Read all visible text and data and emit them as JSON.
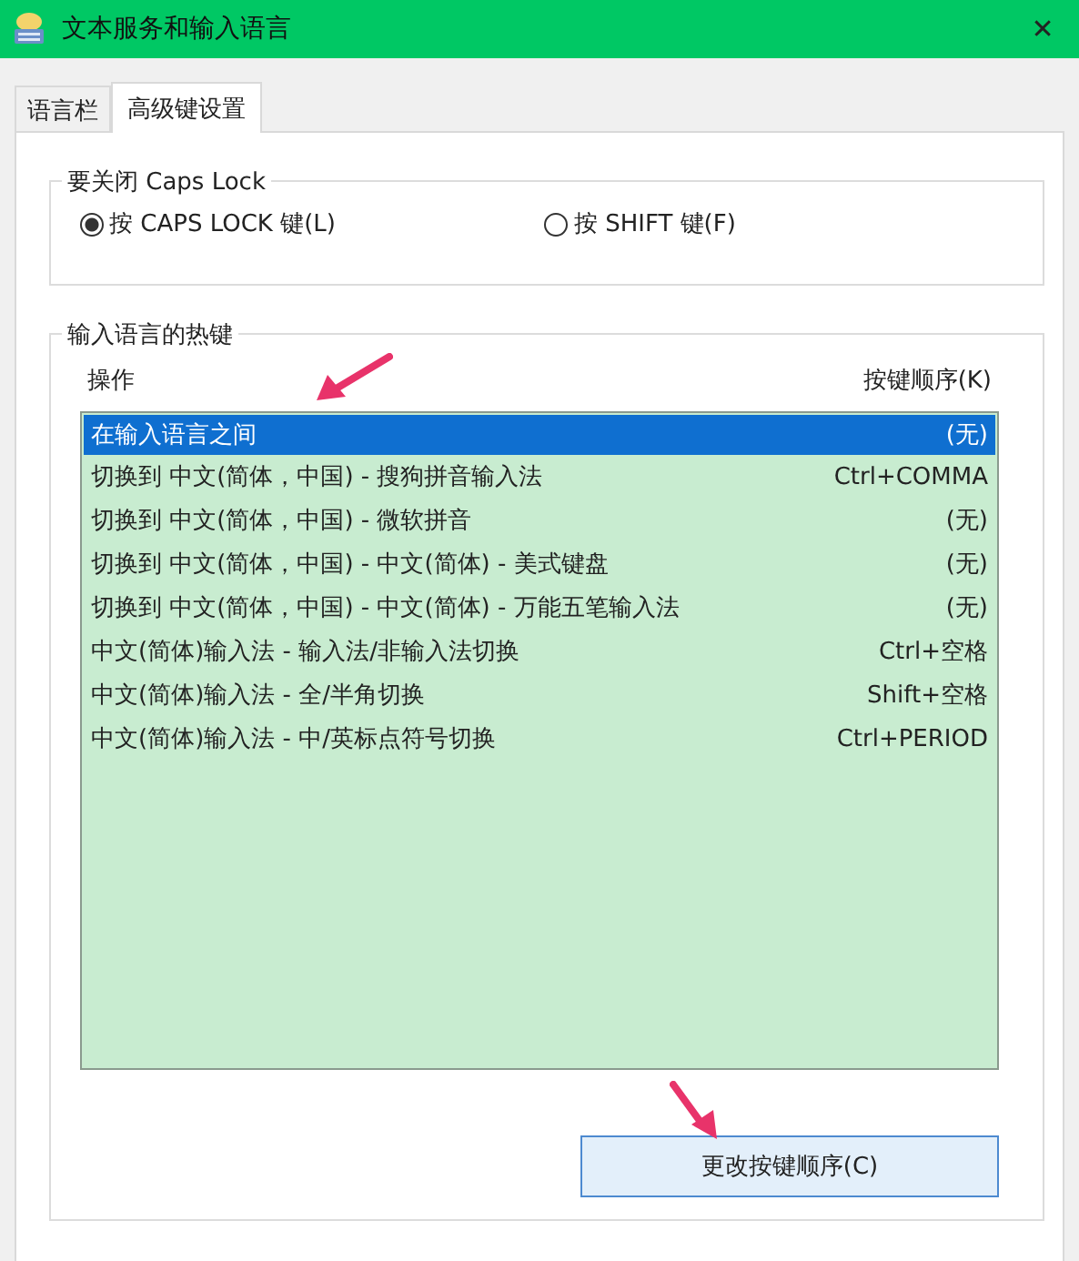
{
  "window": {
    "title": "文本服务和输入语言",
    "close": "✕"
  },
  "tabs": [
    {
      "label": "语言栏",
      "selected": false
    },
    {
      "label": "高级键设置",
      "selected": true
    }
  ],
  "caps_lock": {
    "title": "要关闭 Caps Lock",
    "options": [
      {
        "label": "按 CAPS LOCK 键(L)",
        "selected": true
      },
      {
        "label": "按 SHIFT 键(F)",
        "selected": false
      }
    ]
  },
  "hotkeys": {
    "title": "输入语言的热键",
    "columns": [
      "操作",
      "按键顺序(K)"
    ],
    "rows": [
      {
        "action": "在输入语言之间",
        "keys": "(无)",
        "selected": true
      },
      {
        "action": "切换到 中文(简体，中国) - 搜狗拼音输入法",
        "keys": "Ctrl+COMMA",
        "selected": false
      },
      {
        "action": "切换到 中文(简体，中国) - 微软拼音",
        "keys": "(无)",
        "selected": false
      },
      {
        "action": "切换到 中文(简体，中国) - 中文(简体) - 美式键盘",
        "keys": "(无)",
        "selected": false
      },
      {
        "action": "切换到 中文(简体，中国) - 中文(简体) - 万能五笔输入法",
        "keys": "(无)",
        "selected": false
      },
      {
        "action": "中文(简体)输入法 - 输入法/非输入法切换",
        "keys": "Ctrl+空格",
        "selected": false
      },
      {
        "action": "中文(简体)输入法 - 全/半角切换",
        "keys": "Shift+空格",
        "selected": false
      },
      {
        "action": "中文(简体)输入法 - 中/英标点符号切换",
        "keys": "Ctrl+PERIOD",
        "selected": false
      }
    ],
    "button": "更改按键顺序(C)"
  }
}
